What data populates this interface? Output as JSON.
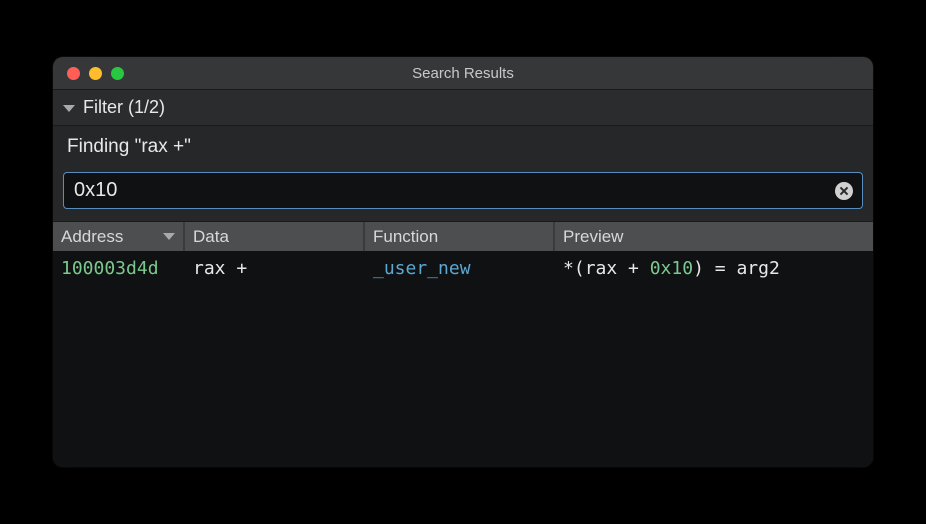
{
  "window": {
    "title": "Search Results"
  },
  "filter": {
    "header": "Filter (1/2)",
    "finding_label": "Finding \"rax +\"",
    "search_value": "0x10"
  },
  "table": {
    "headers": {
      "address": "Address",
      "data": "Data",
      "function": "Function",
      "preview": "Preview"
    },
    "rows": [
      {
        "address": "100003d4d",
        "data": "rax +",
        "function": "_user_new",
        "preview_tokens": {
          "star": "*",
          "lparen": "(",
          "reg": "rax",
          "plus": " + ",
          "num": "0x10",
          "rparen": ")",
          "eq": " = ",
          "arg": "arg2"
        }
      }
    ]
  }
}
